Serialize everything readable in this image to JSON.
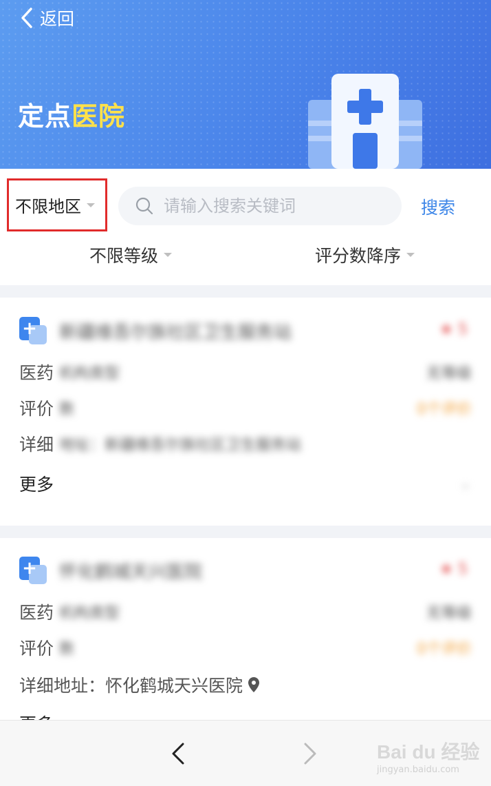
{
  "header": {
    "back_label": "返回",
    "title_part1": "定点",
    "title_part2": "医院"
  },
  "filters": {
    "region": "不限地区",
    "search_placeholder": "请输入搜索关键词",
    "search_button": "搜索",
    "level": "不限等级",
    "sort": "评分数降序"
  },
  "hospitals": [
    {
      "name": "新疆维吾尔族社区卫生服务站",
      "rating": "★ 5",
      "org_type_label": "医药",
      "org_type_value": "机构类型",
      "level": "无等级",
      "review_label": "评价",
      "review_value": "数",
      "review_count": "0个评价",
      "address_label": "详细",
      "address_value": "地址：新疆维吾尔族社区卫生服务站",
      "more_label": "更多"
    },
    {
      "name": "怀化鹤城天兴医院",
      "rating": "★ 5",
      "org_type_label": "医药",
      "org_type_value": "机构类型",
      "level": "无等级",
      "review_label": "评价",
      "review_value": "数",
      "review_count": "0个评价",
      "address_label": "详细地址：",
      "address_value": "怀化鹤城天兴医院",
      "more_label": "更多"
    }
  ],
  "watermark": {
    "logo": "Bai du 经验",
    "url": "jingyan.baidu.com"
  },
  "colors": {
    "banner": "#4a84ea",
    "accent_yellow": "#ffe14a",
    "highlight_border": "#e12b2b",
    "link_blue": "#3d86e8",
    "orange": "#f2a23a"
  }
}
